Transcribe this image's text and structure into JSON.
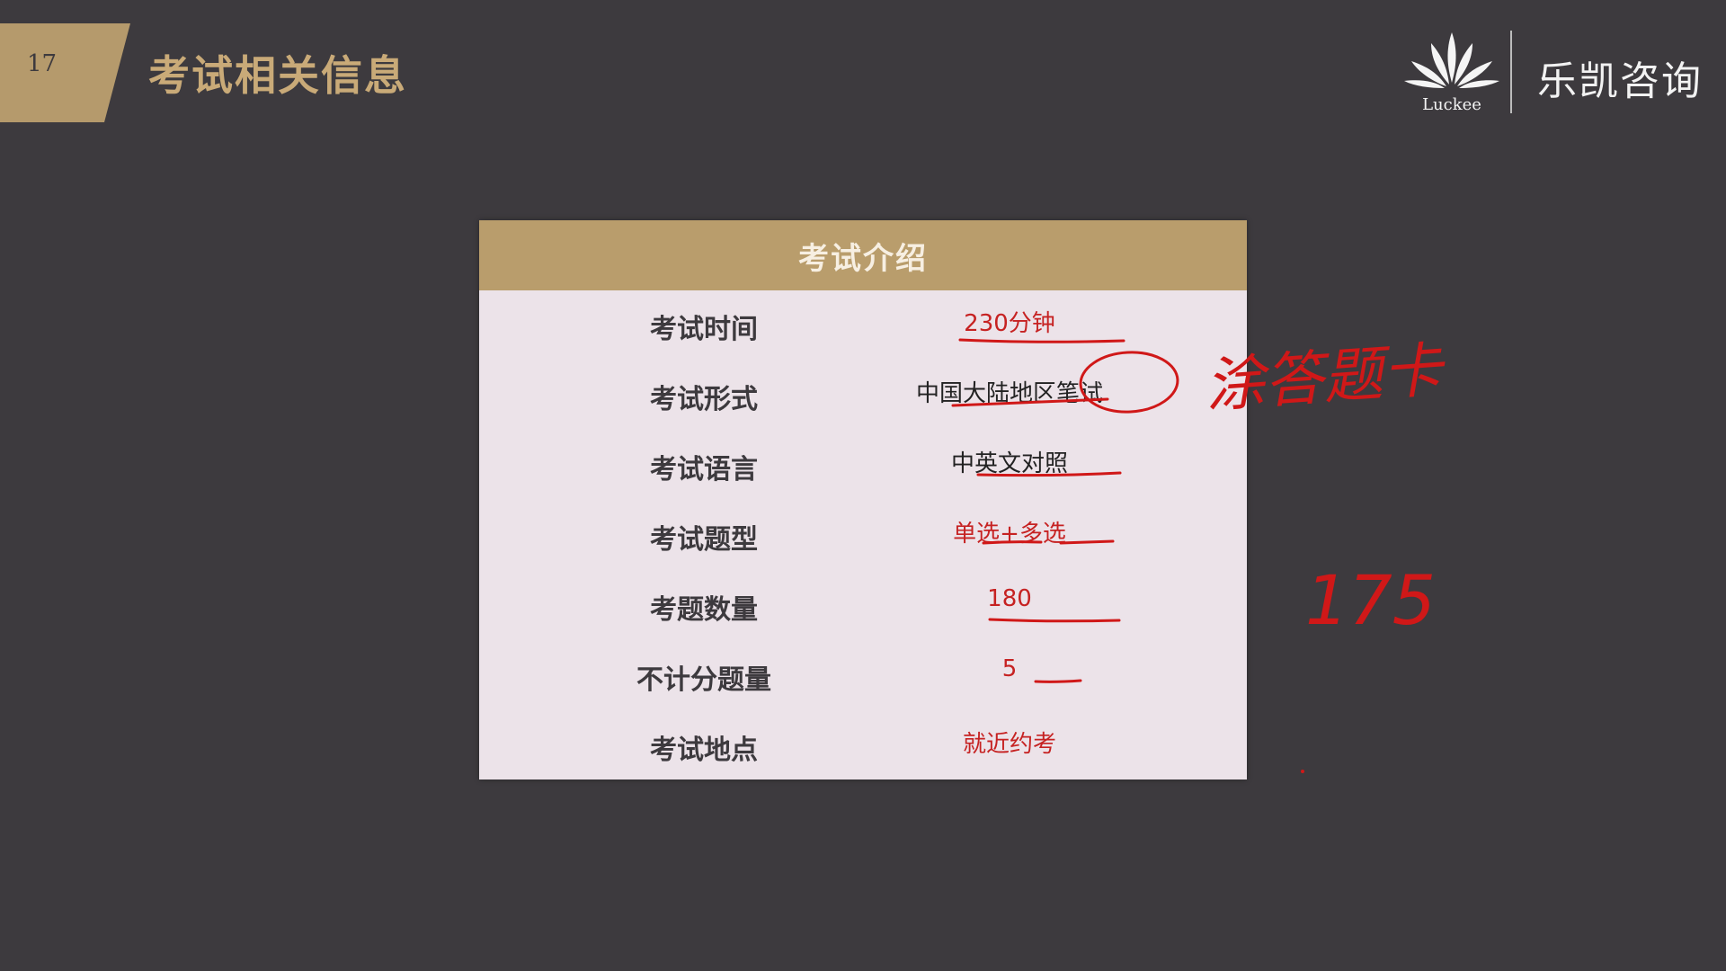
{
  "header": {
    "page_number": "17",
    "title": "考试相关信息"
  },
  "logo": {
    "brand": "Luckee",
    "name_cn": "乐凯咨询"
  },
  "table": {
    "title": "考试介绍",
    "rows": [
      {
        "label": "考试时间",
        "value": "230分钟"
      },
      {
        "label": "考试形式",
        "value": "中国大陆地区笔试"
      },
      {
        "label": "考试语言",
        "value": "中英文对照"
      },
      {
        "label": "考试题型",
        "value": "单选+多选"
      },
      {
        "label": "考题数量",
        "value": "180"
      },
      {
        "label": "不计分题量",
        "value": "5"
      },
      {
        "label": "考试地点",
        "value": "就近约考"
      }
    ]
  },
  "annotations": {
    "handwritten_form": "涂答题卡",
    "handwritten_count": "175"
  },
  "colors": {
    "background": "#3d3a3e",
    "accent_gold": "#b99d6c",
    "ink_red": "#d01818"
  }
}
